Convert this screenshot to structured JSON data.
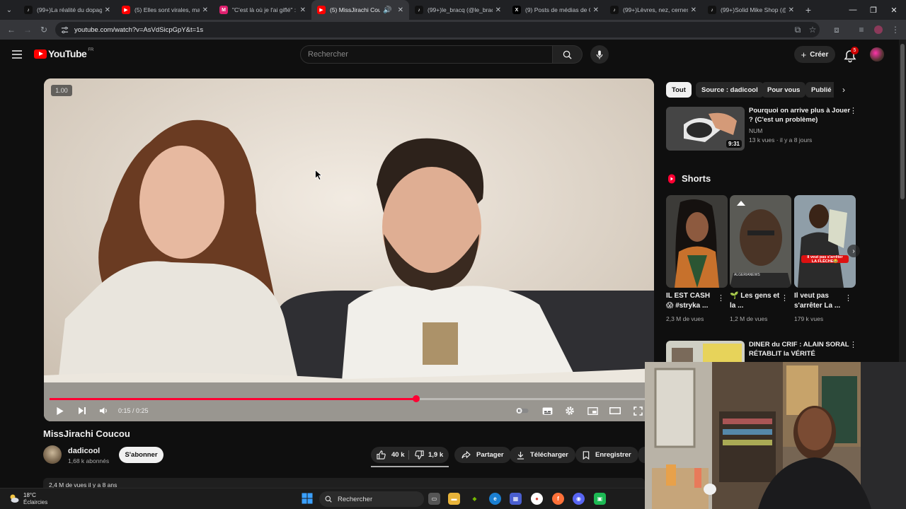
{
  "browser": {
    "tabs": [
      {
        "title": "(99+)La réalité du dopage",
        "icon": "tiktok-icon",
        "color": "#111111"
      },
      {
        "title": "(5) Elles sont virales, mais",
        "icon": "youtube-icon",
        "color": "#ff0000"
      },
      {
        "title": "\"C'est là où je l'ai giflé\" : E",
        "icon": "site-icon",
        "color": "#e0206f"
      },
      {
        "title": "(5) MissJirachi Coucou",
        "icon": "youtube-icon",
        "color": "#ff0000",
        "active": true
      },
      {
        "title": "(99+)le_bracq (@le_bracq",
        "icon": "tiktok-icon",
        "color": "#111111"
      },
      {
        "title": "(9) Posts de médias de C",
        "icon": "x-icon",
        "color": "#000000"
      },
      {
        "title": "(99+)Lèvres, nez, cernes",
        "icon": "tiktok-icon",
        "color": "#111111"
      },
      {
        "title": "(99+)Solid Mike Shop (@",
        "icon": "tiktok-icon",
        "color": "#111111"
      }
    ],
    "url": "youtube.com/watch?v=AsVdSicpGpY&t=1s"
  },
  "header": {
    "logo_text": "YouTube",
    "logo_region": "FR",
    "search_placeholder": "Rechercher",
    "create_label": "Créer",
    "notification_count": "5"
  },
  "player": {
    "speed_label": "1.00",
    "time_current": "0:15",
    "time_separator": " / ",
    "time_total": "0:25",
    "progress_fraction": 0.615,
    "accent": "#ff0033"
  },
  "video": {
    "title": "MissJirachi Coucou",
    "channel": "dadicool",
    "subscribers": "1,68 k abonnés",
    "subscribe_label": "S'abonner",
    "likes": "40 k",
    "dislikes": "1,9 k",
    "share_label": "Partager",
    "download_label": "Télécharger",
    "save_label": "Enregistrer",
    "description_peek": "2,4 M de vues  il y a 8 ans"
  },
  "sidebar": {
    "chips": [
      "Tout",
      "Source : dadicool",
      "Pour vous",
      "Publié"
    ],
    "recommendations": [
      {
        "title": "Pourquoi on arrive plus à Jouer ? (C'est un problème)",
        "channel": "NUM",
        "meta": "13 k vues · il y a 8 jours",
        "duration": "9:31"
      },
      {
        "title": "DINER du CRIF : ALAIN SORAL RÉTABLIT la VÉRITÉ",
        "channel": "",
        "meta": "",
        "duration": ""
      }
    ],
    "shorts_label": "Shorts",
    "shorts": [
      {
        "title": "IL EST CASH 😱 #stryka ...",
        "views": "2,3 M de vues"
      },
      {
        "title": "🌱 Les gens et la ...",
        "views": "1,2 M de vues"
      },
      {
        "title": "Il veut pas s'arrêter La ...",
        "views": "179 k vues"
      }
    ],
    "short_overlay_texts": [
      "Il veut pas s'arrêter",
      "LA FLÈCHE😂",
      "ALGERIANEWS"
    ]
  },
  "taskbar": {
    "temperature": "18°C",
    "weather": "Éclaircies",
    "search_label": "Rechercher"
  }
}
